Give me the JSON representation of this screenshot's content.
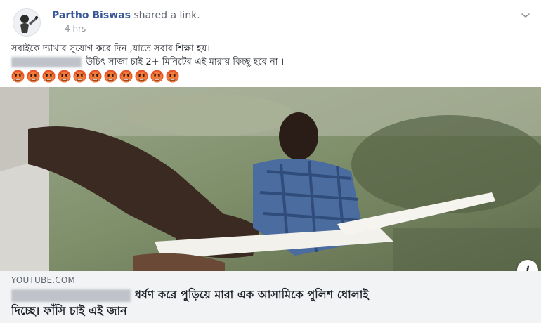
{
  "post": {
    "author": "Partho Biswas",
    "action": "shared a link.",
    "time": "4 hrs",
    "text_line1": "সবাইকে দ্যাখার সুযোগ করে দিন ,যাতে সবার শিক্ষা হয়।",
    "text_line2": "উচিৎ সাজা চাই 2+ মিনিটের এই মারায় কিচ্ছু হবে না ।",
    "emoji_name": "angry-face-icon",
    "emoji_count": 11
  },
  "link": {
    "domain": "YOUTUBE.COM",
    "title_line1": "ধর্ষণ করে পুড়িয়ে মারা এক আসামিকে পুলিশ ধোলাই",
    "title_line2": "দিচ্ছে। ফাঁসি চাই এই জান"
  },
  "icons": {
    "avatar": "avatar",
    "options": "chevron-down-icon",
    "info": "info-icon"
  },
  "colors": {
    "author": "#385898",
    "meta": "#90949c",
    "link_card_bg": "#f2f3f5"
  }
}
